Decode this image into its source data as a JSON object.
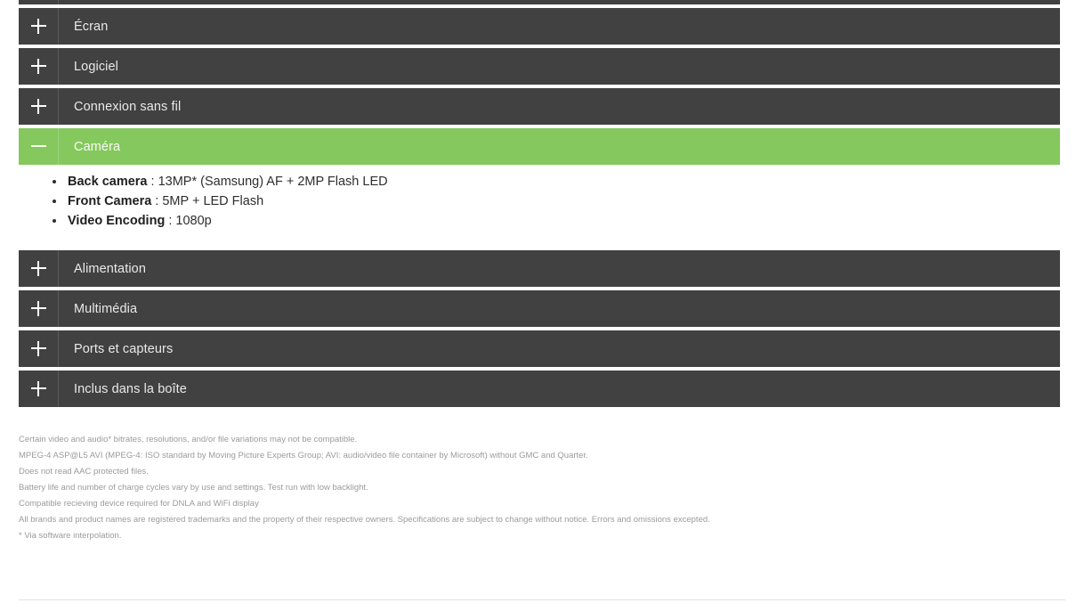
{
  "theme": {
    "header_bg": "#414142",
    "header_open_bg": "#85c85e",
    "header_text": "#e9e9e9",
    "body_text": "#2e2e2e",
    "footnote_text": "#9b9b9b",
    "divider": "#e2e2e4"
  },
  "accordion": {
    "items": [
      {
        "id": "item-truncated",
        "label": "",
        "icon": "plus-icon",
        "state": "collapsed",
        "truncated": true
      },
      {
        "id": "ecran",
        "label": "Écran",
        "icon": "plus-icon",
        "state": "collapsed"
      },
      {
        "id": "logiciel",
        "label": "Logiciel",
        "icon": "plus-icon",
        "state": "collapsed"
      },
      {
        "id": "connexion-sans-fil",
        "label": "Connexion sans fil",
        "icon": "plus-icon",
        "state": "collapsed"
      },
      {
        "id": "camera",
        "label": "Caméra",
        "icon": "minus-icon",
        "state": "expanded"
      },
      {
        "id": "alimentation",
        "label": "Alimentation",
        "icon": "plus-icon",
        "state": "collapsed"
      },
      {
        "id": "multimedia",
        "label": "Multimédia",
        "icon": "plus-icon",
        "state": "collapsed"
      },
      {
        "id": "ports-et-capteurs",
        "label": "Ports et capteurs",
        "icon": "plus-icon",
        "state": "collapsed"
      },
      {
        "id": "inclus-dans-la-boite",
        "label": "Inclus dans la boîte",
        "icon": "plus-icon",
        "state": "collapsed"
      }
    ]
  },
  "camera_panel": {
    "specs": [
      {
        "label": "Back camera",
        "value": " : 13MP* (Samsung) AF + 2MP Flash LED"
      },
      {
        "label": "Front Camera",
        "value": " : 5MP + LED Flash"
      },
      {
        "label": "Video Encoding",
        "value": " : 1080p"
      }
    ]
  },
  "footnotes": {
    "lines": [
      "Certain video and audio* bitrates, resolutions, and/or file variations may not be compatible.",
      "MPEG-4 ASP@L5 AVI (MPEG-4: ISO standard by Moving Picture Experts Group; AVI: audio/video file container by Microsoft) without GMC and Quarter.",
      "Does not read AAC protected files.",
      "Battery life and number of charge cycles vary by use and settings. Test run with low backlight.",
      "Compatible recieving device required for DNLA and WiFi display",
      "All brands and product names are registered trademarks and the property of their respective owners. Specifications are subject to change without notice. Errors and omissions excepted.",
      "* Via software interpolation."
    ]
  }
}
